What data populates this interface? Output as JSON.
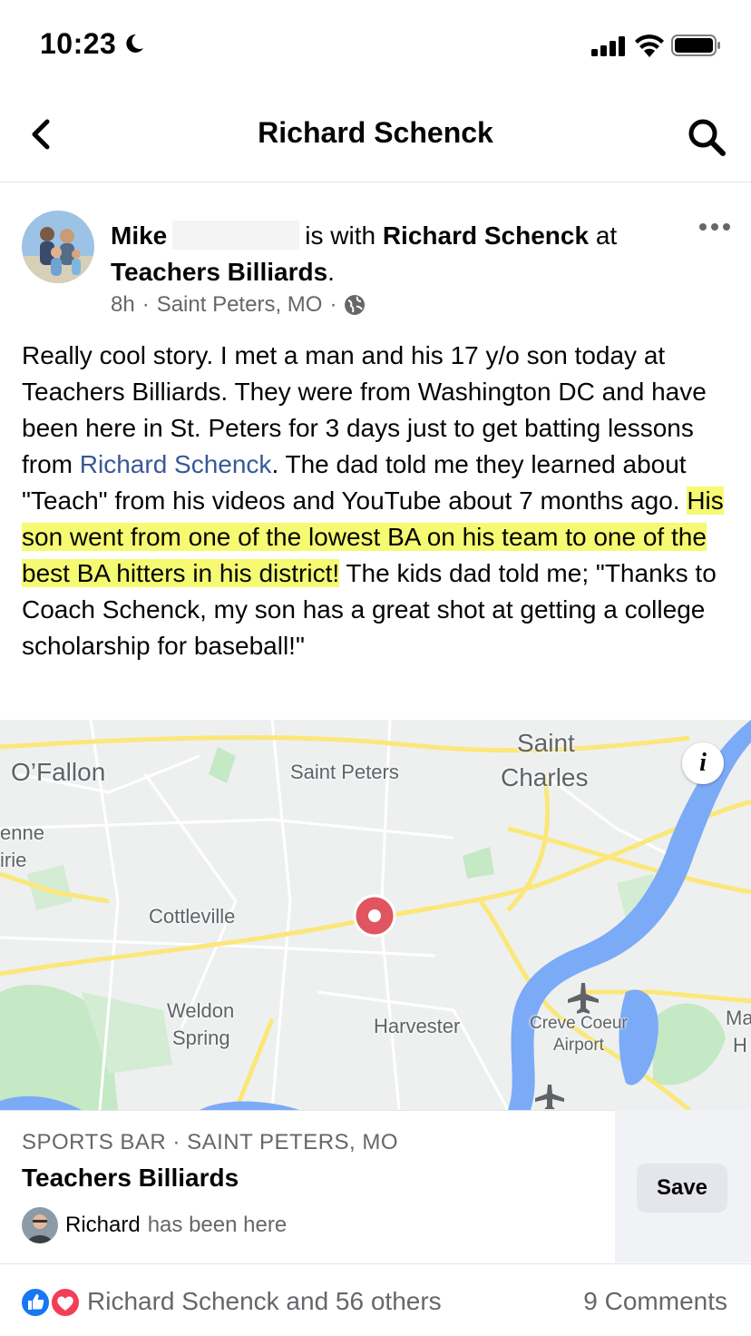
{
  "status_bar": {
    "time": "10:23"
  },
  "nav": {
    "title": "Richard Schenck",
    "back_icon": "chevron-left-icon",
    "search_icon": "search-icon"
  },
  "post": {
    "author": "Mike",
    "with_text": "is with",
    "tagged": "Richard Schenck",
    "at_text": "at",
    "place": "Teachers Billiards",
    "time": "8h",
    "location": "Saint Peters, MO",
    "audience_icon": "globe-icon",
    "body_part1": "Really cool story. I met a man and his 17 y/o son today at Teachers Billiards. They were from Washington DC and have been here in St. Peters for 3 days just to get batting lessons from ",
    "body_link": "Richard Schenck",
    "body_part2": ". The dad told me they learned about \"Teach\" from his videos and YouTube about 7 months ago. ",
    "body_highlight": "His son went from one of the lowest BA on his team to one of the best BA hitters in his district!",
    "body_part3": " The kids dad told me; \"Thanks to Coach Schenck, my son has a great shot at getting a college scholarship for baseball!\""
  },
  "map": {
    "labels": {
      "ofallon": "O’Fallon",
      "saint_peters": "Saint Peters",
      "saint_charles_1": "Saint",
      "saint_charles_2": "Charles",
      "enne": "enne",
      "irie": "irie",
      "cottleville": "Cottleville",
      "weldon_1": "Weldon",
      "weldon_2": "Spring",
      "harvester": "Harvester",
      "creve_1": "Creve Coeur",
      "creve_2": "Airport",
      "ma": "Ma",
      "h": "H"
    },
    "info_label": "i",
    "colors": {
      "water": "#7baaf7",
      "road": "#fbe77a",
      "park": "#c5e8c5",
      "pin": "#e0555f"
    }
  },
  "place_card": {
    "category": "SPORTS BAR · SAINT PETERS, MO",
    "name": "Teachers Billiards",
    "visitor_name": "Richard",
    "visitor_text": "has been here",
    "save_label": "Save"
  },
  "footer": {
    "reactions_text": "Richard Schenck and 56 others",
    "comments_text": "9 Comments",
    "reaction_icons": [
      "like-icon",
      "love-icon"
    ]
  }
}
